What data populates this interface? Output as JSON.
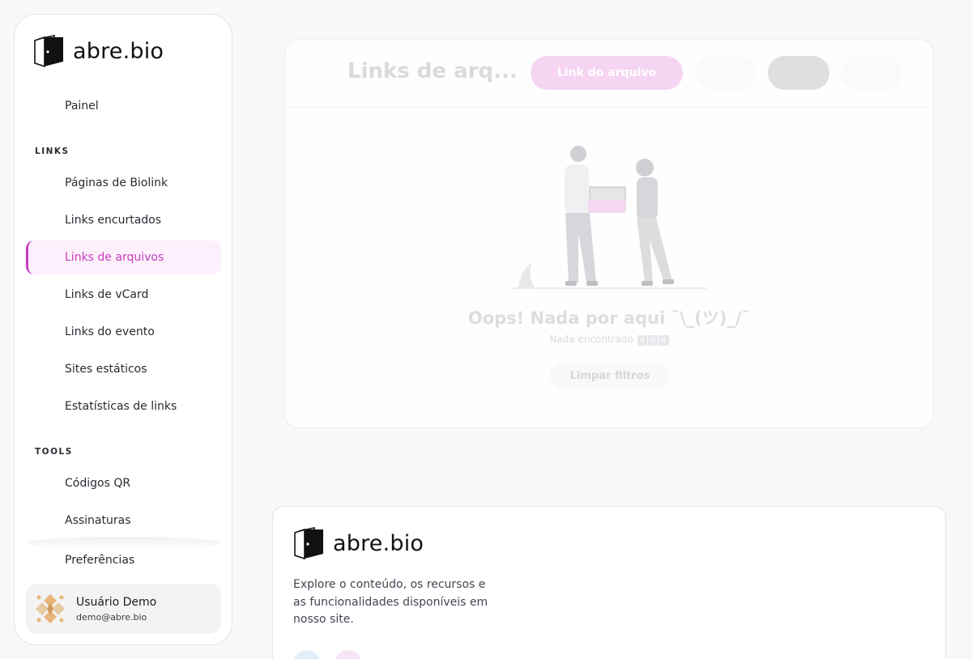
{
  "brand": {
    "name": "abre.bio"
  },
  "sidebar": {
    "items": [
      {
        "label": "Painel"
      },
      {
        "label": "Páginas de Biolink"
      },
      {
        "label": "Links encurtados"
      },
      {
        "label": "Links de arquivos",
        "active": true
      },
      {
        "label": "Links de vCard"
      },
      {
        "label": "Links do evento"
      },
      {
        "label": "Sites estáticos"
      },
      {
        "label": "Estatísticas de links"
      },
      {
        "label": "Códigos QR"
      },
      {
        "label": "Assinaturas"
      },
      {
        "label": "Preferências"
      }
    ],
    "sections": {
      "links": "LINKS",
      "tools": "TOOLS"
    }
  },
  "user": {
    "name": "Usuário Demo",
    "email": "demo@abre.bio"
  },
  "main": {
    "title": "Links de arq...",
    "primary_button": "Link do arquivo",
    "empty": {
      "title": "Oops! Nada por aqui ¯\\_(ツ)_/¯",
      "subtitle": "Nada encontrado",
      "code": [
        "4",
        "0",
        "4"
      ],
      "clear_button": "Limpar filtros"
    }
  },
  "footer": {
    "brand": "abre.bio",
    "description": "Explore o conteúdo, os recursos e as funcionalidades disponíveis em nosso site."
  },
  "colors": {
    "accent": "#c63ec0",
    "accent_bg": "#fdf0fc",
    "accent_soft": "#f5d4f2"
  }
}
